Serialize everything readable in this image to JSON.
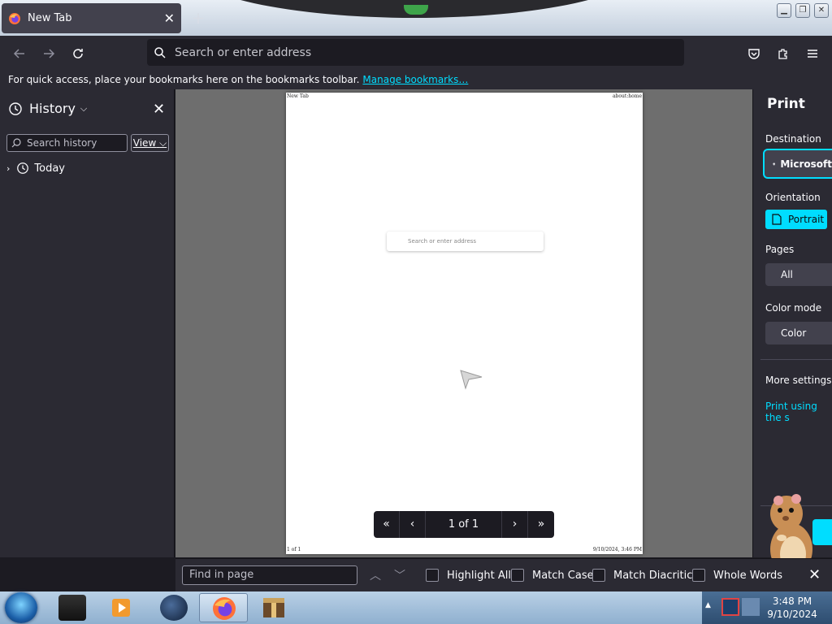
{
  "browser": {
    "tab_title": "New Tab",
    "tab_close_icon": "close-icon",
    "new_tab_icon": "plus-icon",
    "url_placeholder": "Search or enter address"
  },
  "bookmarks_bar": {
    "text": "For quick access, place your bookmarks here on the bookmarks toolbar.",
    "link": "Manage bookmarks…"
  },
  "sidebar": {
    "title": "History",
    "search_placeholder": "Search history",
    "view_label": "View",
    "items": [
      {
        "label": "Today"
      }
    ]
  },
  "preview": {
    "header_left": "New Tab",
    "header_right": "about:home",
    "search_placeholder": "Search or enter address",
    "footer_left": "1 of 1",
    "footer_right": "9/10/2024, 3:46 PM",
    "page_indicator": "1 of 1"
  },
  "print": {
    "title": "Print",
    "destination_label": "Destination",
    "destination_value": "Microsoft",
    "orientation_label": "Orientation",
    "orientation_value": "Portrait",
    "pages_label": "Pages",
    "pages_value": "All",
    "color_mode_label": "Color mode",
    "color_mode_value": "Color",
    "more_settings": "More settings",
    "system_dialog_link": "Print using the s"
  },
  "findbar": {
    "placeholder": "Find in page",
    "highlight_all": "Highlight All",
    "match_case": "Match Case",
    "match_diacritics": "Match Diacritics",
    "whole_words": "Whole Words"
  },
  "taskbar": {
    "time": "3:48 PM",
    "date": "9/10/2024"
  },
  "colors": {
    "accent": "#00ddff",
    "toolbar": "#2b2a33",
    "field": "#1c1b22"
  }
}
